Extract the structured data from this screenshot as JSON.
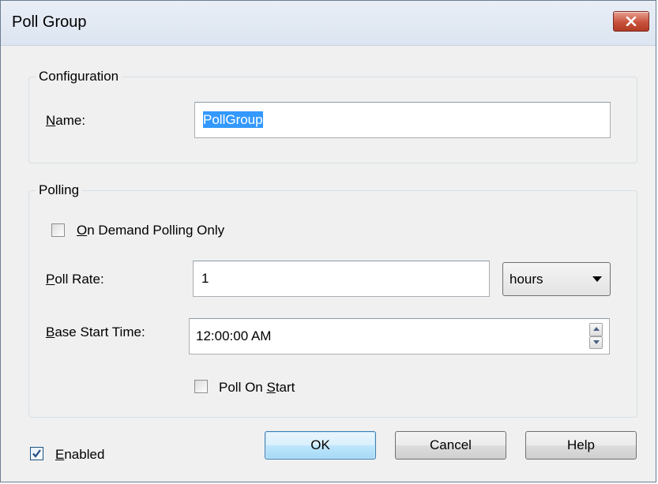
{
  "window": {
    "title": "Poll Group"
  },
  "configuration": {
    "legend": "Configuration",
    "name_label": {
      "access": "N",
      "rest": "ame:"
    },
    "name_value": "PollGroup"
  },
  "polling": {
    "legend": "Polling",
    "on_demand": {
      "access": "O",
      "rest": "n Demand Polling Only",
      "checked": false
    },
    "poll_rate_label": {
      "access": "P",
      "rest": "oll Rate:"
    },
    "poll_rate_value": "1",
    "poll_rate_unit": "hours",
    "base_start_label": {
      "access": "B",
      "rest": "ase Start Time:"
    },
    "base_start_value": "12:00:00 AM",
    "poll_on_start": {
      "before": "Poll On ",
      "access": "S",
      "after": "tart",
      "checked": false
    }
  },
  "footer": {
    "enabled": {
      "access": "E",
      "rest": "nabled",
      "checked": true
    },
    "ok_label": "OK",
    "cancel_label": "Cancel",
    "help_label": "Help"
  },
  "colors": {
    "close_button": "#c9523d",
    "selection": "#3399ff",
    "default_button_border": "#3c7fb1"
  }
}
